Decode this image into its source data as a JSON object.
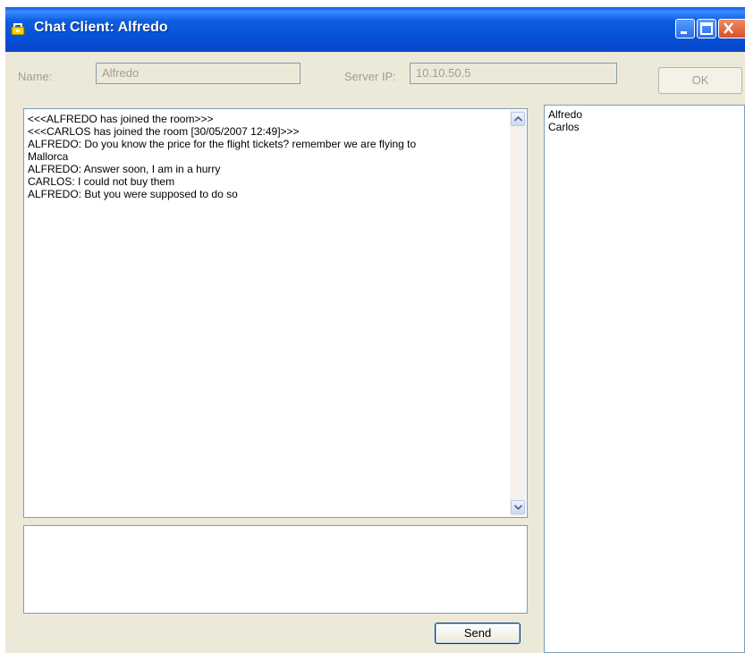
{
  "window": {
    "title": "Chat Client: Alfredo"
  },
  "connection": {
    "name_label": "Name:",
    "name_value": "Alfredo",
    "server_label": "Server IP:",
    "server_value": "10.10.50.5",
    "ok_label": "OK"
  },
  "chat": {
    "lines": [
      "<<<ALFREDO has joined the room>>>",
      "<<<CARLOS has joined the room [30/05/2007 12:49]>>>",
      "ALFREDO: Do you know the price for the flight tickets? remember we are flying to",
      "Mallorca",
      "ALFREDO: Answer soon, I am in a hurry",
      "CARLOS: I could not buy them",
      "ALFREDO: But you were supposed to do so"
    ],
    "input_value": "",
    "send_label": "Send"
  },
  "users": [
    "Alfredo",
    "Carlos"
  ]
}
